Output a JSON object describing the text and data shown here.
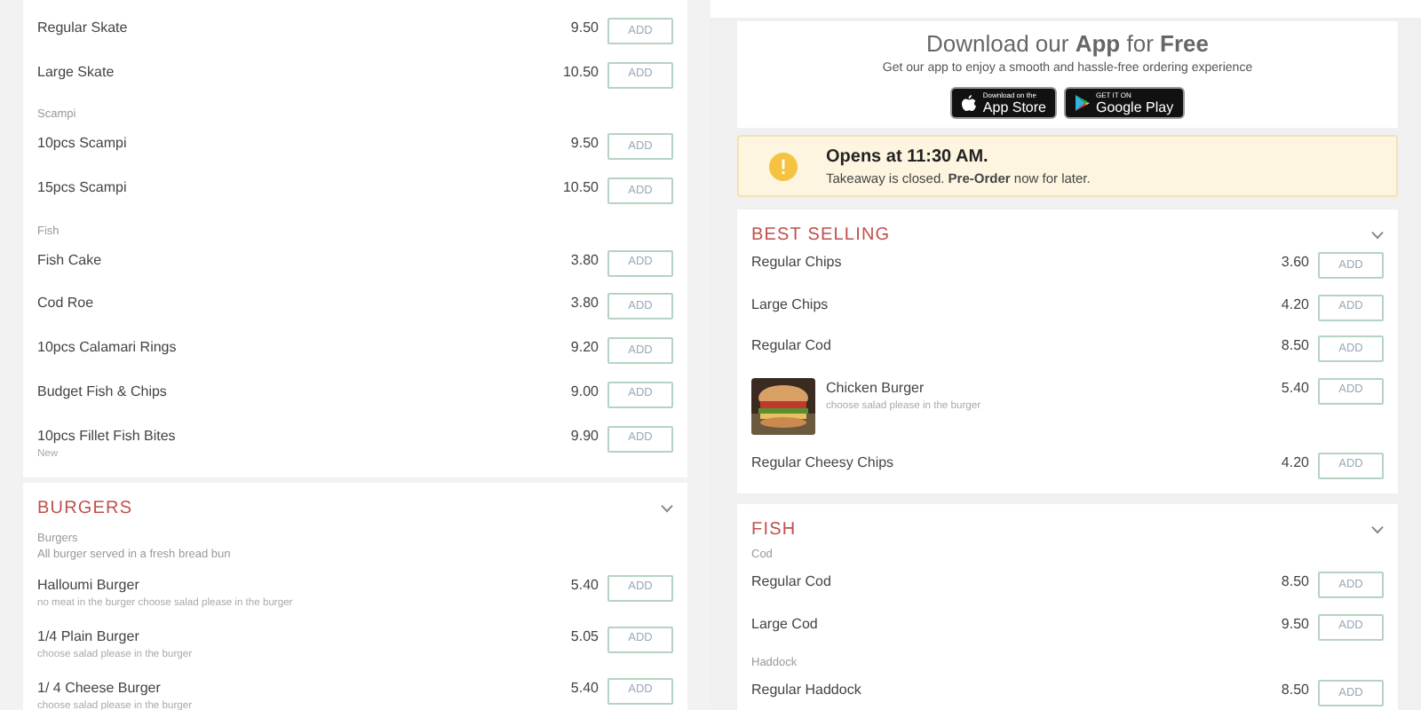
{
  "left_column": {
    "sections": [
      {
        "groups": [
          {
            "items": [
              {
                "name": "Regular Skate",
                "price": "9.50",
                "button": "ADD"
              },
              {
                "name": "Large Skate",
                "price": "10.50",
                "button": "ADD"
              }
            ]
          },
          {
            "name": "Scampi",
            "items": [
              {
                "name": "10pcs Scampi",
                "price": "9.50",
                "button": "ADD"
              },
              {
                "name": "15pcs Scampi",
                "price": "10.50",
                "button": "ADD"
              }
            ]
          },
          {
            "name": "Fish",
            "items": [
              {
                "name": "Fish Cake",
                "price": "3.80",
                "button": "ADD"
              },
              {
                "name": "Cod Roe",
                "price": "3.80",
                "button": "ADD"
              },
              {
                "name": "10pcs Calamari Rings",
                "price": "9.20",
                "button": "ADD"
              },
              {
                "name": "Budget Fish & Chips",
                "price": "9.00",
                "button": "ADD"
              },
              {
                "name": "10pcs Fillet Fish Bites",
                "description": "New",
                "price": "9.90",
                "button": "ADD"
              }
            ]
          }
        ]
      },
      {
        "title": "BURGERS",
        "groups": [
          {
            "name": "Burgers",
            "description": "All burger served in a fresh bread bun",
            "items": [
              {
                "name": "Halloumi Burger",
                "description": "no meat in the burger choose salad please in the burger",
                "price": "5.40",
                "button": "ADD"
              },
              {
                "name": "1/4 Plain Burger",
                "description": "choose salad please in the burger",
                "price": "5.05",
                "button": "ADD"
              },
              {
                "name": "1/ 4 Cheese Burger",
                "description": "choose salad please in the burger",
                "price": "5.40",
                "button": "ADD"
              }
            ]
          }
        ]
      }
    ]
  },
  "right_column": {
    "app_banner": {
      "title": "Download our **App** for **Free**",
      "subtitle": "Get our app to enjoy a smooth and hassle-free ordering experience",
      "badges": [
        {
          "kind": "apple",
          "small": "Download on the",
          "large": "App Store"
        },
        {
          "kind": "google",
          "small": "GET IT ON",
          "large": "Google Play"
        }
      ]
    },
    "opening_notice": {
      "title": "Opens at 11:30 AM.",
      "text": "Takeaway is closed. **Pre-Order** now for later."
    },
    "sections": [
      {
        "title": "BEST SELLING",
        "groups": [
          {
            "items": [
              {
                "kind": "plain",
                "name": "Regular Chips",
                "price": "3.60",
                "button": "ADD"
              },
              {
                "kind": "plain",
                "name": "Large Chips",
                "price": "4.20",
                "button": "ADD"
              },
              {
                "kind": "plain",
                "name": "Regular Cod",
                "price": "8.50",
                "button": "ADD"
              },
              {
                "name": "Chicken Burger",
                "description": "choose salad please in the burger",
                "price": "5.40",
                "button": "ADD"
              },
              {
                "kind": "plain",
                "name": "Regular Cheesy Chips",
                "price": "4.20",
                "button": "ADD"
              }
            ]
          }
        ]
      },
      {
        "title": "FISH",
        "groups": [
          {
            "name": "Cod",
            "items": [
              {
                "name": "Regular Cod",
                "price": "8.50",
                "button": "ADD"
              },
              {
                "name": "Large Cod",
                "price": "9.50",
                "button": "ADD"
              }
            ]
          },
          {
            "name": "Haddock",
            "items": [
              {
                "name": "Regular Haddock",
                "price": "8.50",
                "button": "ADD"
              }
            ]
          }
        ]
      }
    ]
  }
}
